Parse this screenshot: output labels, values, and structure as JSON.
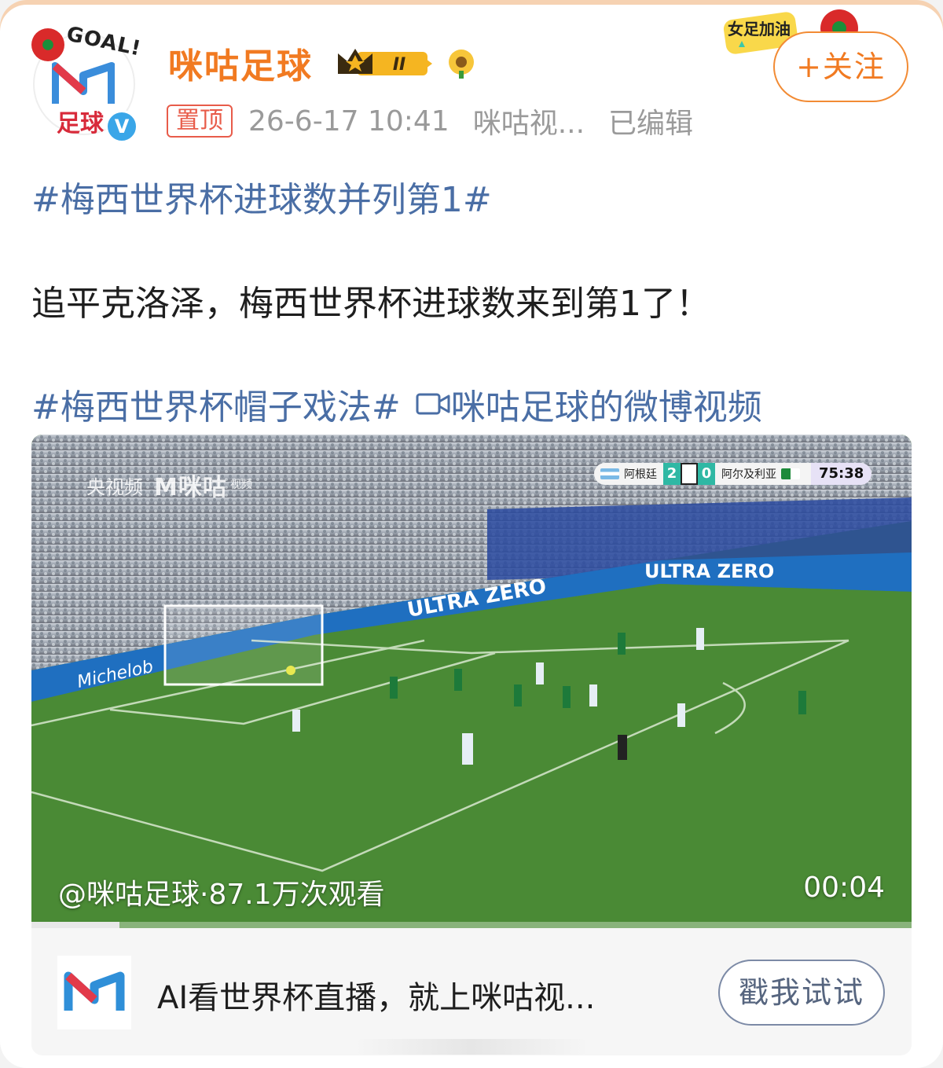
{
  "account": {
    "name": "咪咕足球",
    "avatar_text": "GOAL!",
    "avatar_sub": "足球",
    "verified_badge": "V",
    "rank_badge": "II",
    "follow_label": "+关注",
    "deco_text": "女足加油"
  },
  "post_meta": {
    "pinned_label": "置顶",
    "timestamp": "26-6-17 10:41",
    "source": "咪咕视...",
    "edited": "已编辑"
  },
  "post": {
    "topic1": "#梅西世界杯进球数并列第1#",
    "body": "追平克洛泽，梅西世界杯进球数来到第1了！",
    "topic2": "#梅西世界杯帽子戏法#",
    "video_link": "咪咕足球的微博视频"
  },
  "video": {
    "watermark_cctv": "央视频",
    "watermark_migu": "M咪咕",
    "watermark_sub": "视频",
    "scoreboard": {
      "home_team": "阿根廷",
      "home_score": "2",
      "away_score": "0",
      "away_team": "阿尔及利亚",
      "match_clock": "75:38"
    },
    "ad_boards": [
      "Michelob",
      "ULTRA ZERO"
    ],
    "stats": "@咪咕足球·87.1万次观看",
    "duration": "00:04",
    "progress": 0.1
  },
  "ad": {
    "text": "AI看世界杯直播，就上咪咕视...",
    "button": "戳我试试"
  },
  "colors": {
    "name": "#f17a21",
    "topic": "#4a6ea5",
    "pitch": "#3f7a2c"
  }
}
